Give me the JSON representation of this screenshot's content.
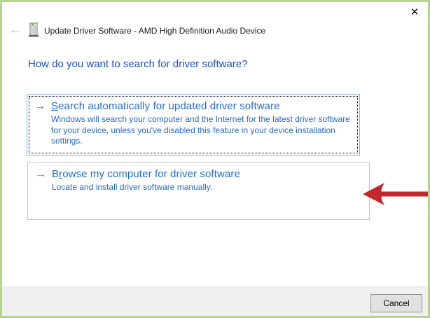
{
  "window": {
    "title": "Update Driver Software - AMD High Definition Audio Device"
  },
  "icons": {
    "back": "←",
    "close": "✕",
    "command_arrow": "→"
  },
  "heading": "How do you want to search for driver software?",
  "options": [
    {
      "title_pre": "",
      "title_accel": "S",
      "title_post": "earch automatically for updated driver software",
      "description": "Windows will search your computer and the Internet for the latest driver software for your device, unless you've disabled this feature in your device installation settings."
    },
    {
      "title_pre": "B",
      "title_accel": "r",
      "title_post": "owse my computer for driver software",
      "description": "Locate and install driver software manually."
    }
  ],
  "footer": {
    "cancel_label": "Cancel"
  },
  "colors": {
    "frame_green": "#b3d689",
    "heading_blue": "#1d4ecb",
    "link_blue": "#2569d9",
    "focus_border_blue": "#7eb4ea",
    "annotation_arrow_red": "#c3272b",
    "footer_gray": "#f0f0f0",
    "cancel_button_gray": "#e1e1e1"
  }
}
